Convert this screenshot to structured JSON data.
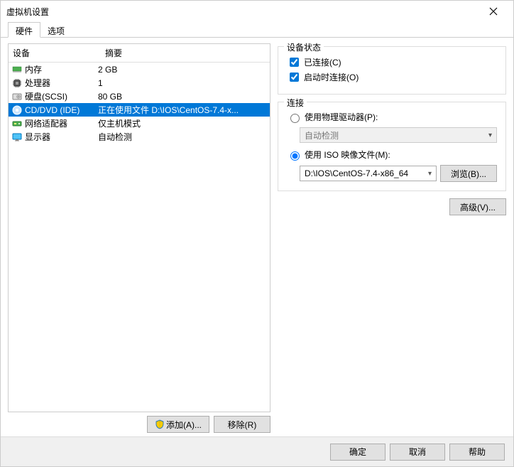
{
  "window": {
    "title": "虚拟机设置"
  },
  "tabs": {
    "hardware": "硬件",
    "options": "选项"
  },
  "headers": {
    "device": "设备",
    "summary": "摘要"
  },
  "devices": [
    {
      "name": "内存",
      "summary": "2 GB",
      "icon": "memory"
    },
    {
      "name": "处理器",
      "summary": "1",
      "icon": "cpu"
    },
    {
      "name": "硬盘(SCSI)",
      "summary": "80 GB",
      "icon": "disk"
    },
    {
      "name": "CD/DVD (IDE)",
      "summary": "正在使用文件 D:\\IOS\\CentOS-7.4-x...",
      "icon": "cd",
      "selected": true
    },
    {
      "name": "网络适配器",
      "summary": "仅主机模式",
      "icon": "net"
    },
    {
      "name": "显示器",
      "summary": "自动检测",
      "icon": "display"
    }
  ],
  "buttons": {
    "add": "添加(A)...",
    "remove": "移除(R)",
    "browse": "浏览(B)...",
    "advanced": "高级(V)...",
    "ok": "确定",
    "cancel": "取消",
    "help": "帮助"
  },
  "state_group": {
    "legend": "设备状态",
    "connected": "已连接(C)",
    "connect_on_power": "启动时连接(O)"
  },
  "conn_group": {
    "legend": "连接",
    "use_physical": "使用物理驱动器(P):",
    "auto_detect": "自动检测",
    "use_iso": "使用 ISO 映像文件(M):",
    "iso_path": "D:\\IOS\\CentOS-7.4-x86_64"
  }
}
